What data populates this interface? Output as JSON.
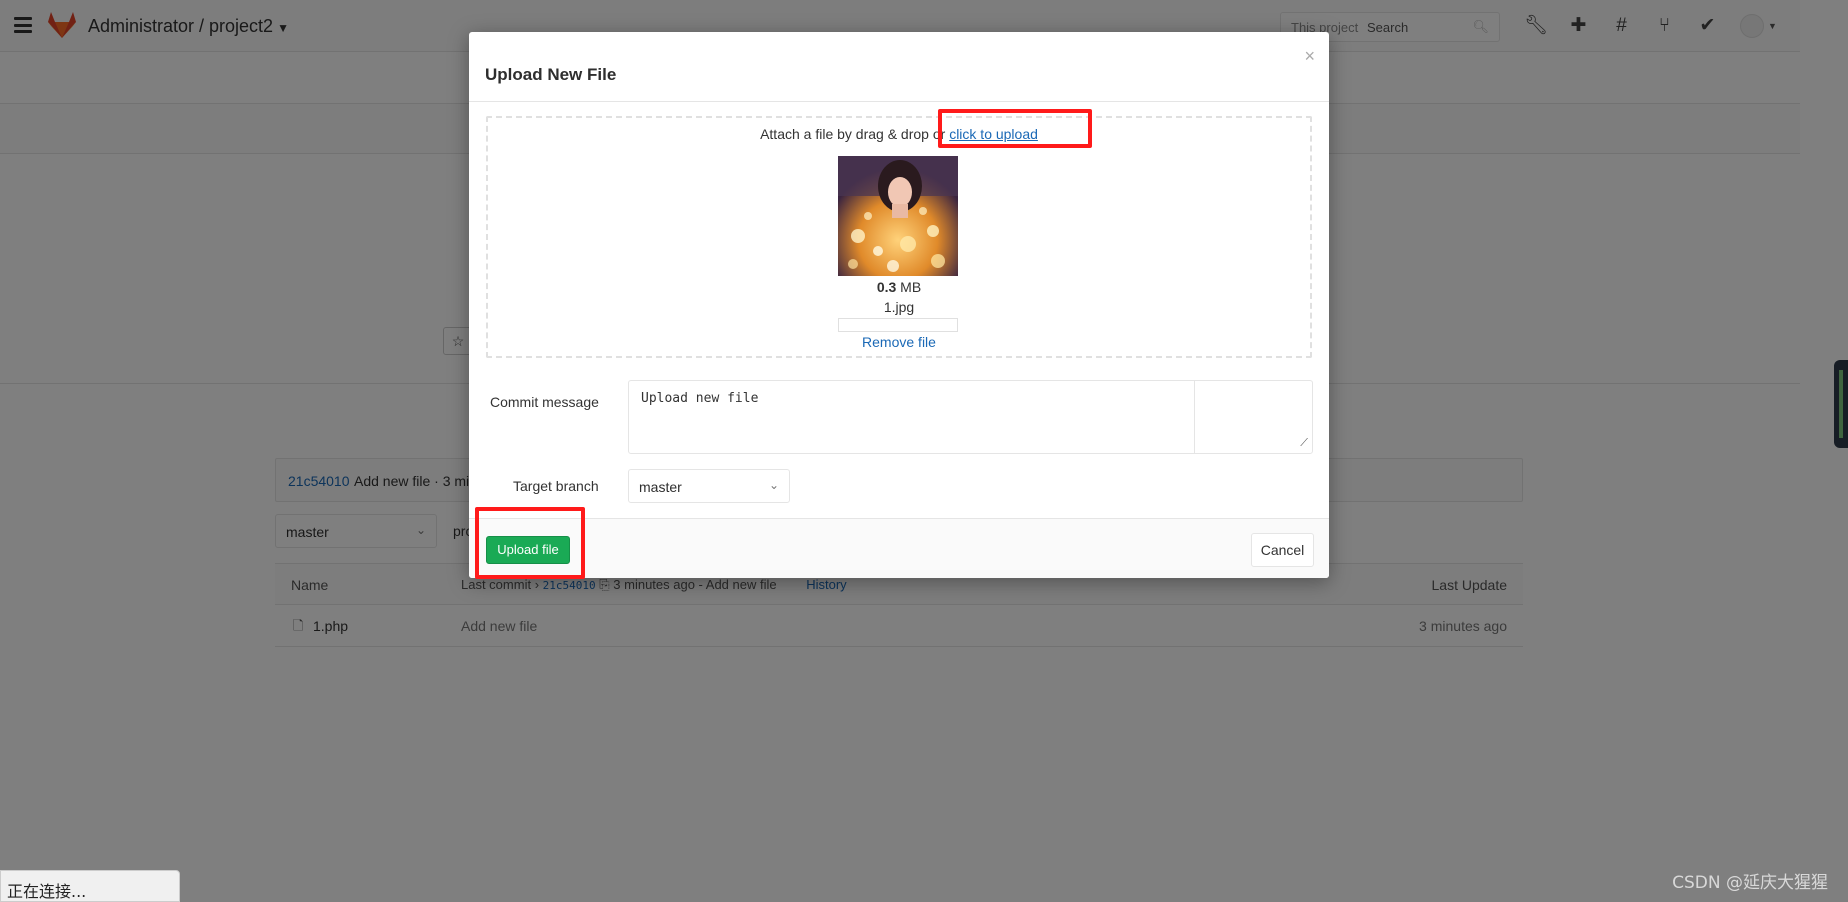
{
  "navbar": {
    "title": "Administrator / project2",
    "search_scope": "This project",
    "search_placeholder": "Search",
    "icons": [
      "admin-wrench-icon",
      "plus-icon",
      "issues-hash-icon",
      "merge-request-icon",
      "todo-check-icon"
    ]
  },
  "background": {
    "commit_sha": "21c54010",
    "commit_msg": "Add new file · 3 mi",
    "branch": "master",
    "path": "pro",
    "table": {
      "col_name": "Name",
      "col_last_commit": "Last commit",
      "last_commit_sha": "21c54010",
      "last_commit_info": "3 minutes ago - Add new file",
      "history": "History",
      "col_last_update": "Last Update",
      "rows": [
        {
          "name": "1.php",
          "message": "Add new file",
          "updated": "3 minutes ago"
        }
      ]
    }
  },
  "modal": {
    "title": "Upload New File",
    "close": "×",
    "dropzone": {
      "text": "Attach a file by drag & drop or",
      "link": "click to upload",
      "size_value": "0.3",
      "size_unit": "MB",
      "filename": "1.jpg",
      "progress": 0,
      "remove": "Remove file"
    },
    "commit_label": "Commit message",
    "commit_value": "Upload new file",
    "branch_label": "Target branch",
    "branch_value": "master",
    "upload_button": "Upload file",
    "cancel_button": "Cancel"
  },
  "status_bar": "正在连接...",
  "watermark": "CSDN @延庆大猩猩",
  "colors": {
    "primary_green": "#1aaa55",
    "link_blue": "#1b69b6",
    "highlight_red": "#ff1a1a"
  }
}
